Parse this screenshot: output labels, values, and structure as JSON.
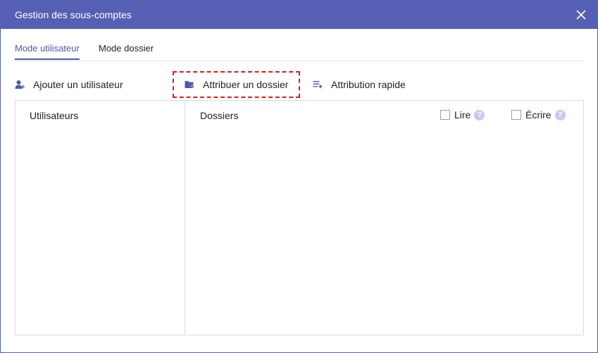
{
  "dialog": {
    "title": "Gestion des sous-comptes",
    "close_icon": "close-icon"
  },
  "tabs": [
    {
      "label": "Mode utilisateur",
      "active": true
    },
    {
      "label": "Mode dossier",
      "active": false
    }
  ],
  "toolbar": {
    "add_user": {
      "label": "Ajouter un utilisateur",
      "icon": "add-user-icon"
    },
    "assign_folder": {
      "label": "Attribuer un dossier",
      "icon": "folder-add-icon",
      "highlighted": true
    },
    "quick_assign": {
      "label": "Attribution rapide",
      "icon": "list-add-icon"
    }
  },
  "panel": {
    "users_header": "Utilisateurs",
    "folders_header": "Dossiers",
    "read_label": "Lire",
    "write_label": "Écrire",
    "help_symbol": "?"
  },
  "colors": {
    "titlebar": "#5560b4",
    "accent": "#4e58a8",
    "highlight": "#dd1c1c",
    "help_icon": "#c3cbf0"
  }
}
